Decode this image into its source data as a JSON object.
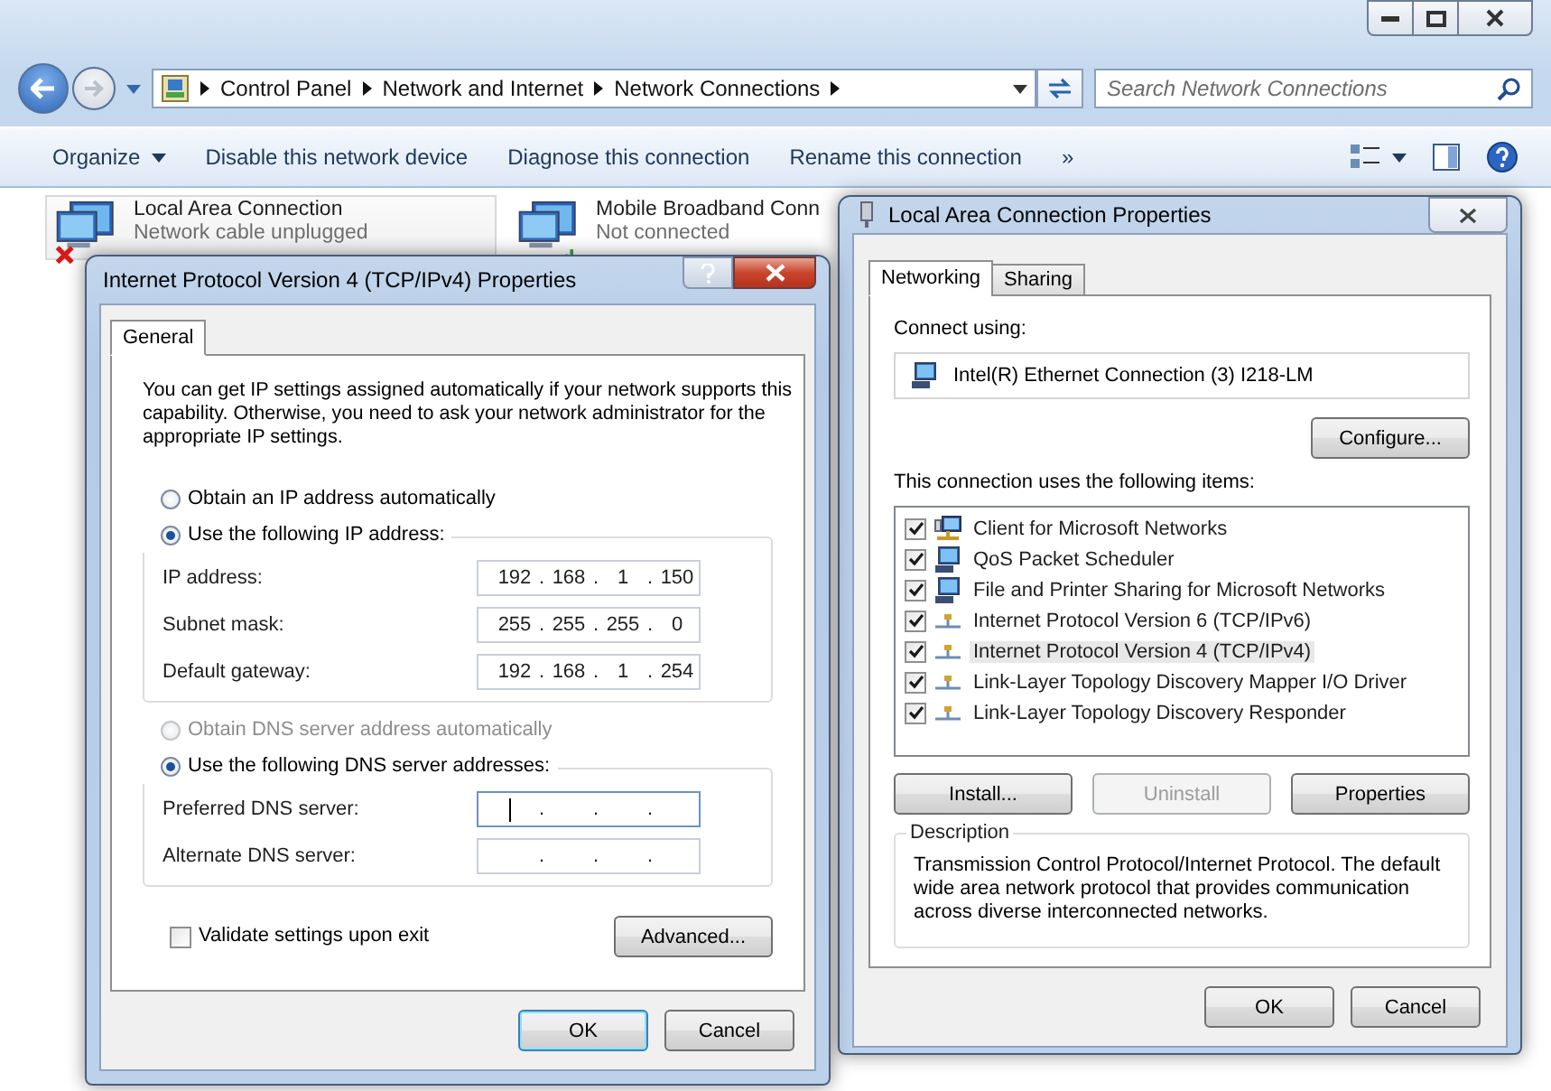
{
  "explorer": {
    "breadcrumb": [
      "Control Panel",
      "Network and Internet",
      "Network Connections"
    ],
    "search": {
      "placeholder": "Search Network Connections"
    },
    "toolbar": [
      {
        "label": "Organize",
        "menu": true
      },
      {
        "label": "Disable this network device",
        "menu": false
      },
      {
        "label": "Diagnose this connection",
        "menu": false
      },
      {
        "label": "Rename this connection",
        "menu": false
      },
      {
        "label": "»",
        "menu": false
      }
    ],
    "connections": [
      {
        "name": "Local Area Connection",
        "status": "Network cable unplugged",
        "kind": "ethernet",
        "selected": true
      },
      {
        "name": "Mobile Broadband Conn",
        "status": "Not connected",
        "kind": "broadband",
        "selected": false
      }
    ]
  },
  "ipv4_dialog": {
    "title": "Internet Protocol Version 4 (TCP/IPv4) Properties",
    "tabs": [
      {
        "label": "General",
        "selected": true
      }
    ],
    "intro": "You can get IP settings assigned automatically if your network supports this capability. Otherwise, you need to ask your network administrator for the appropriate IP settings.",
    "octet_separator": ".",
    "ip_options": [
      {
        "label": "Obtain an IP address automatically",
        "selected": false,
        "disabled": false
      },
      {
        "label": "Use the following IP address:",
        "selected": true,
        "disabled": false
      }
    ],
    "ip_fields": [
      {
        "label": "IP address:",
        "octets": [
          "192",
          "168",
          "1",
          "150"
        ],
        "focused": false
      },
      {
        "label": "Subnet mask:",
        "octets": [
          "255",
          "255",
          "255",
          "0"
        ],
        "focused": false
      },
      {
        "label": "Default gateway:",
        "octets": [
          "192",
          "168",
          "1",
          "254"
        ],
        "focused": false
      }
    ],
    "dns_options": [
      {
        "label": "Obtain DNS server address automatically",
        "selected": false,
        "disabled": true
      },
      {
        "label": "Use the following DNS server addresses:",
        "selected": true,
        "disabled": false
      }
    ],
    "dns_fields": [
      {
        "label": "Preferred DNS server:",
        "focused": true
      },
      {
        "label": "Alternate DNS server:",
        "focused": false
      }
    ],
    "validate": {
      "label": "Validate settings upon exit",
      "checked": false
    },
    "advanced": "Advanced...",
    "buttons": [
      {
        "label": "OK",
        "default": true
      },
      {
        "label": "Cancel",
        "default": false
      }
    ]
  },
  "lac_dialog": {
    "title": "Local Area Connection Properties",
    "tabs": [
      {
        "label": "Networking",
        "selected": true
      },
      {
        "label": "Sharing",
        "selected": false
      }
    ],
    "connect_using": "Connect using:",
    "adapter": "Intel(R) Ethernet Connection (3) I218-LM",
    "configure": "Configure...",
    "items_label": "This connection uses the following items:",
    "items": [
      {
        "label": "Client for Microsoft Networks",
        "kind": "client",
        "checked": true,
        "selected": false
      },
      {
        "label": "QoS Packet Scheduler",
        "kind": "service",
        "checked": true,
        "selected": false
      },
      {
        "label": "File and Printer Sharing for Microsoft Networks",
        "kind": "service",
        "checked": true,
        "selected": false
      },
      {
        "label": "Internet Protocol Version 6 (TCP/IPv6)",
        "kind": "protocol",
        "checked": true,
        "selected": false
      },
      {
        "label": "Internet Protocol Version 4 (TCP/IPv4)",
        "kind": "protocol",
        "checked": true,
        "selected": true
      },
      {
        "label": "Link-Layer Topology Discovery Mapper I/O Driver",
        "kind": "protocol",
        "checked": true,
        "selected": false
      },
      {
        "label": "Link-Layer Topology Discovery Responder",
        "kind": "protocol",
        "checked": true,
        "selected": false
      }
    ],
    "item_buttons": [
      {
        "label": "Install...",
        "disabled": false
      },
      {
        "label": "Uninstall",
        "disabled": true
      },
      {
        "label": "Properties",
        "disabled": false
      }
    ],
    "description": {
      "title": "Description",
      "text": "Transmission Control Protocol/Internet Protocol. The default wide area network protocol that provides communication across diverse interconnected networks."
    },
    "buttons": [
      {
        "label": "OK",
        "default": false
      },
      {
        "label": "Cancel",
        "default": false
      }
    ]
  }
}
